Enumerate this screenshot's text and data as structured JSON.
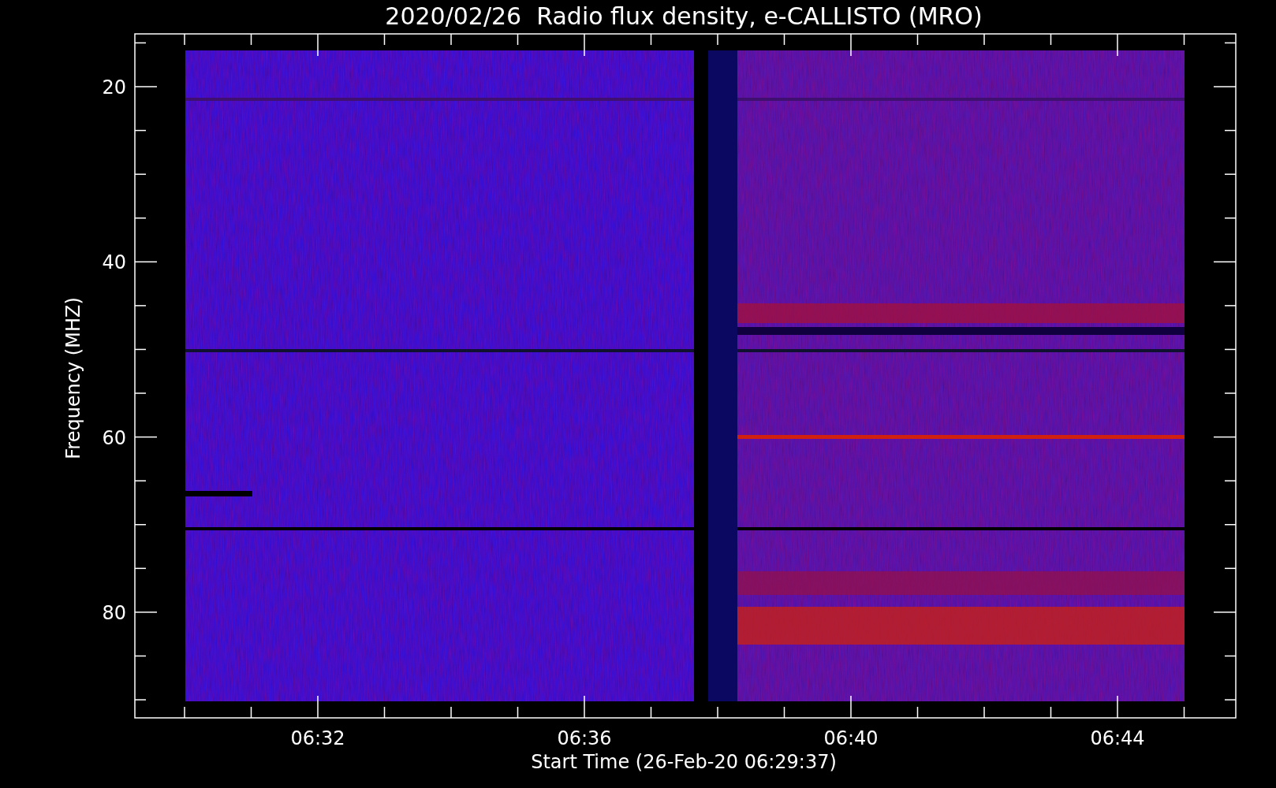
{
  "title": "2020/02/26  Radio flux density, e-CALLISTO (MRO)",
  "y_axis": {
    "label": "Frequency (MHZ)",
    "ticks": [
      "20",
      "40",
      "60",
      "80"
    ]
  },
  "x_axis": {
    "label": "Start Time (26-Feb-20 06:29:37)",
    "ticks": [
      "06:32",
      "06:36",
      "06:40",
      "06:44"
    ]
  }
}
